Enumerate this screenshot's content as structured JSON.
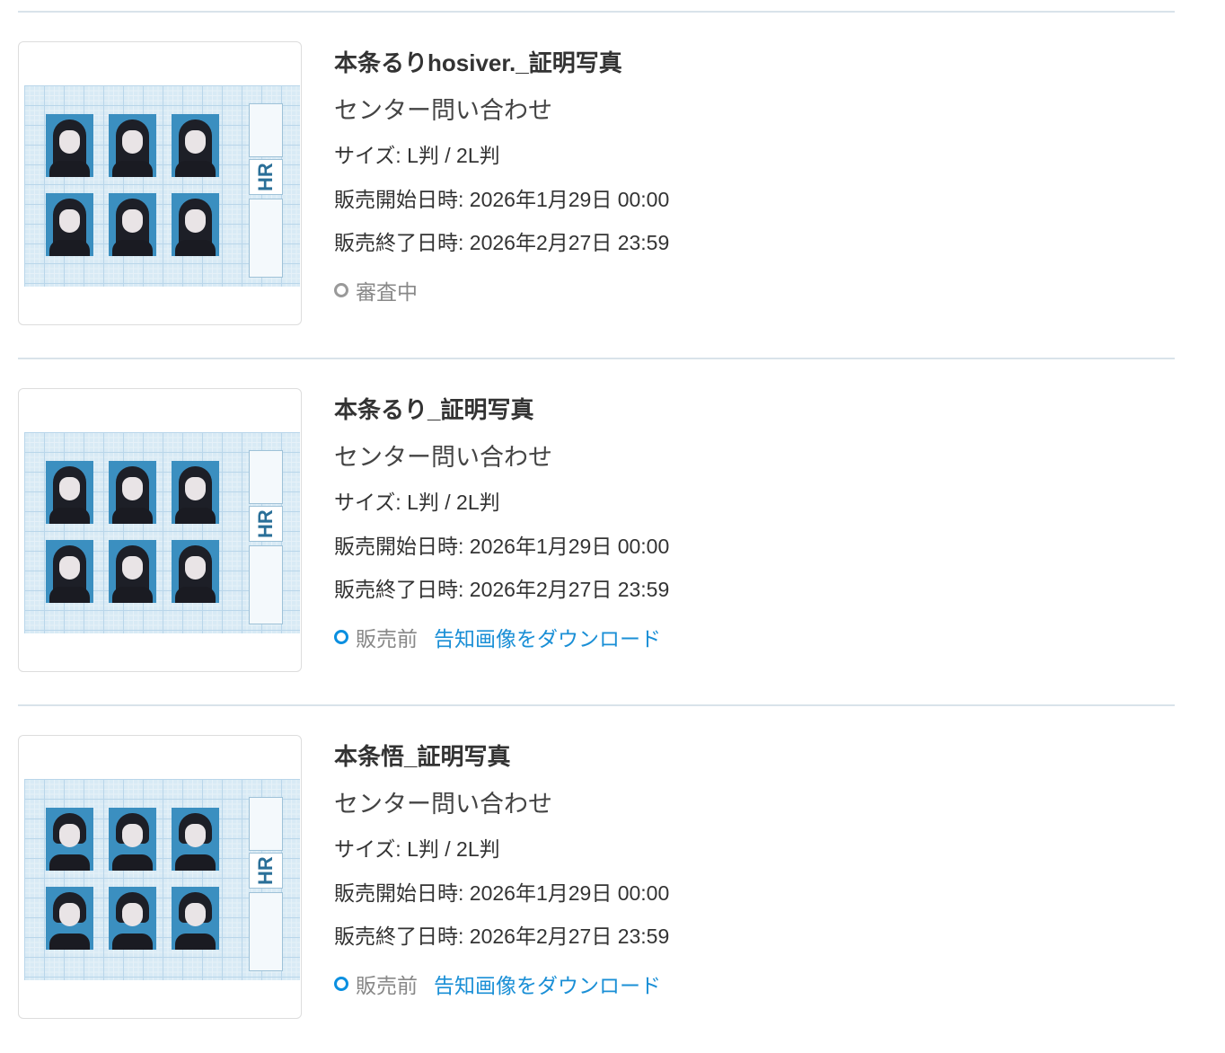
{
  "items": [
    {
      "title": "本条るりhosiver._証明写真",
      "subtitle": "センター問い合わせ",
      "size": "サイズ: L判 / 2L判",
      "sale_start": "販売開始日時: 2026年1月29日 00:00",
      "sale_end": "販売終了日時: 2026年2月27日 23:59",
      "status": "審査中",
      "status_color": "#999999",
      "link": "",
      "thumbnail_logo": "HR"
    },
    {
      "title": "本条るり_証明写真",
      "subtitle": "センター問い合わせ",
      "size": "サイズ: L判 / 2L判",
      "sale_start": "販売開始日時: 2026年1月29日 00:00",
      "sale_end": "販売終了日時: 2026年2月27日 23:59",
      "status": "販売前",
      "status_color": "#0a8fe0",
      "link": "告知画像をダウンロード",
      "thumbnail_logo": "HR"
    },
    {
      "title": "本条悟_証明写真",
      "subtitle": "センター問い合わせ",
      "size": "サイズ: L判 / 2L判",
      "sale_start": "販売開始日時: 2026年1月29日 00:00",
      "sale_end": "販売終了日時: 2026年2月27日 23:59",
      "status": "販売前",
      "status_color": "#0a8fe0",
      "link": "告知画像をダウンロード",
      "thumbnail_logo": "HR"
    }
  ],
  "colors": {
    "divider": "#d9e3ea",
    "link": "#1a8fd6",
    "photo_background": "#3b8fc0"
  }
}
